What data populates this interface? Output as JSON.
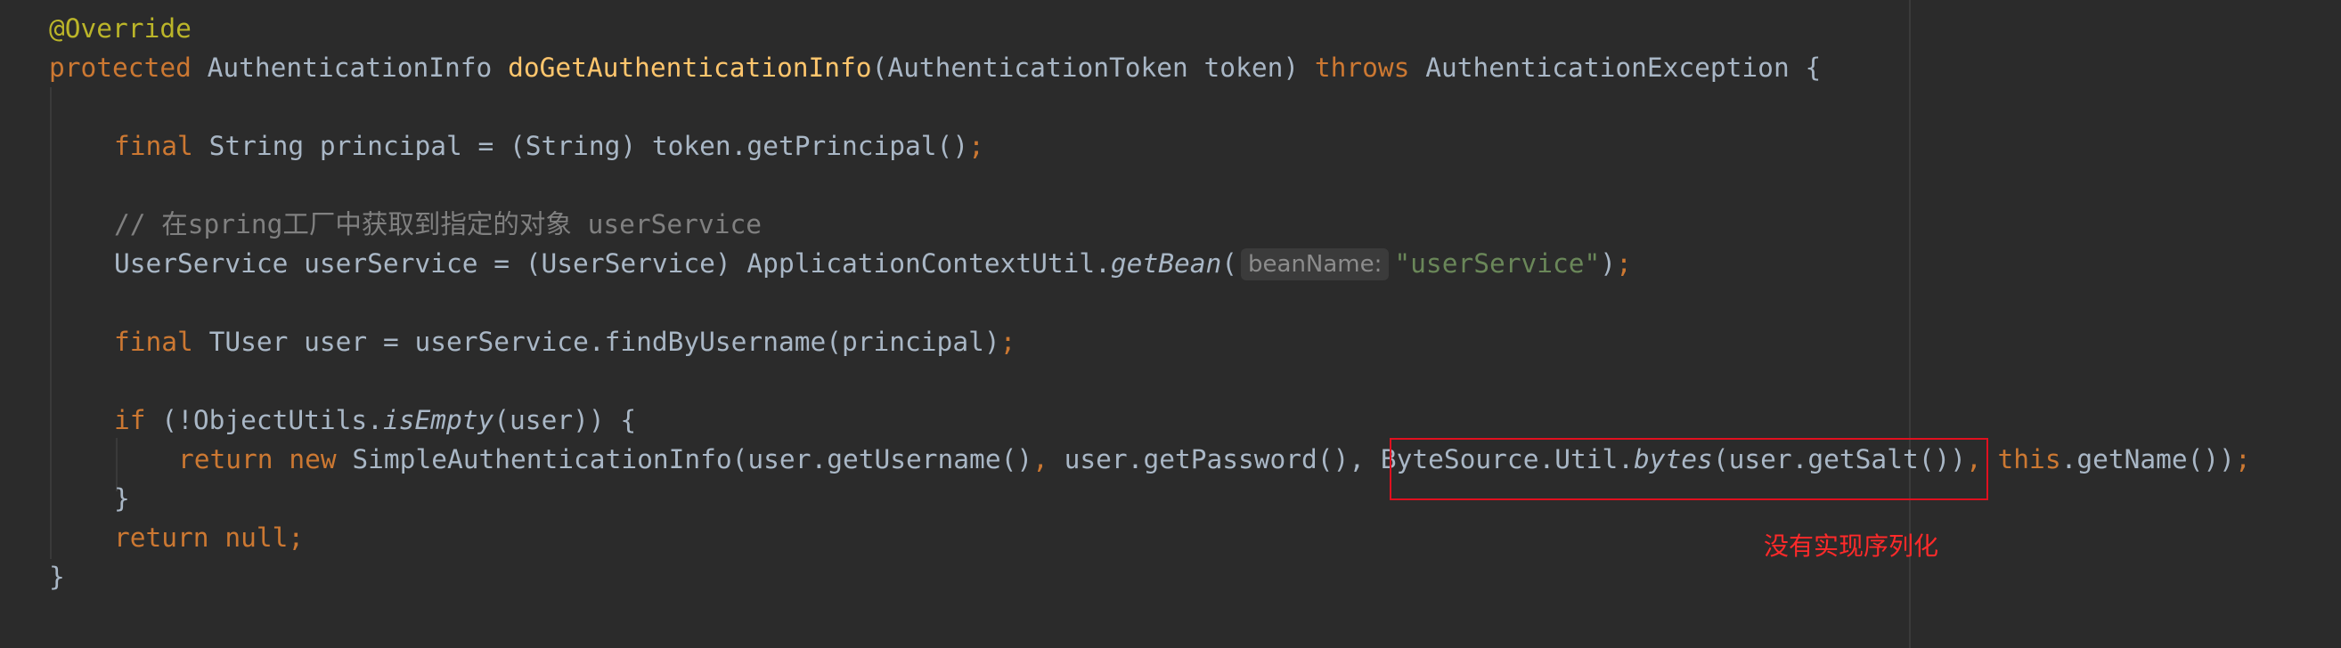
{
  "code": {
    "l1": {
      "annotation": "@Override"
    },
    "l2": {
      "kw_protected": "protected",
      "return_type": " AuthenticationInfo ",
      "method_name": "doGetAuthenticationInfo",
      "params": "(AuthenticationToken token) ",
      "kw_throws": "throws",
      "exception": " AuthenticationException {"
    },
    "l3": {
      "kw_final": "final",
      "body": " String principal = (String) token.getPrincipal()",
      "semi": ";"
    },
    "l4": {
      "comment": "// 在spring工厂中获取到指定的对象 userService"
    },
    "l5": {
      "pre": "UserService userService = (UserService) ApplicationContextUtil.",
      "method": "getBean",
      "open": "(",
      "hint": "beanName:",
      "str": "\"userService\"",
      "close": ")",
      "semi": ";"
    },
    "l6": {
      "kw_final": "final",
      "body": " TUser user = userService.findByUsername(principal)",
      "semi": ";"
    },
    "l7": {
      "kw_if": "if",
      "pre": " (!ObjectUtils.",
      "method": "isEmpty",
      "post": "(user)) {"
    },
    "l8": {
      "kw_return": "return",
      "sp": " ",
      "kw_new": "new",
      "part1": " SimpleAuthenticationInfo(user.getUsername()",
      "comma1": ",",
      "part2": " user.getPassword(), ByteSource.Util.",
      "method": "bytes",
      "part3": "(user.getSalt())",
      "comma2": ",",
      "sp2": " ",
      "kw_this": "this",
      "part4": ".getName())",
      "semi": ";"
    },
    "l9": {
      "brace": "}"
    },
    "l10": {
      "kw_return": "return",
      "sp": " ",
      "kw_null": "null",
      "semi": ";"
    },
    "l11": {
      "brace": "}"
    }
  },
  "annotation_note": "没有实现序列化",
  "colors": {
    "background": "#2b2b2b",
    "default_text": "#a9b7c6",
    "keyword": "#cc7832",
    "method_declaration": "#ffc66d",
    "annotation": "#bbb529",
    "comment": "#808080",
    "string": "#6a8759",
    "highlight_box": "#e0101f",
    "note": "#ff2a2a"
  }
}
